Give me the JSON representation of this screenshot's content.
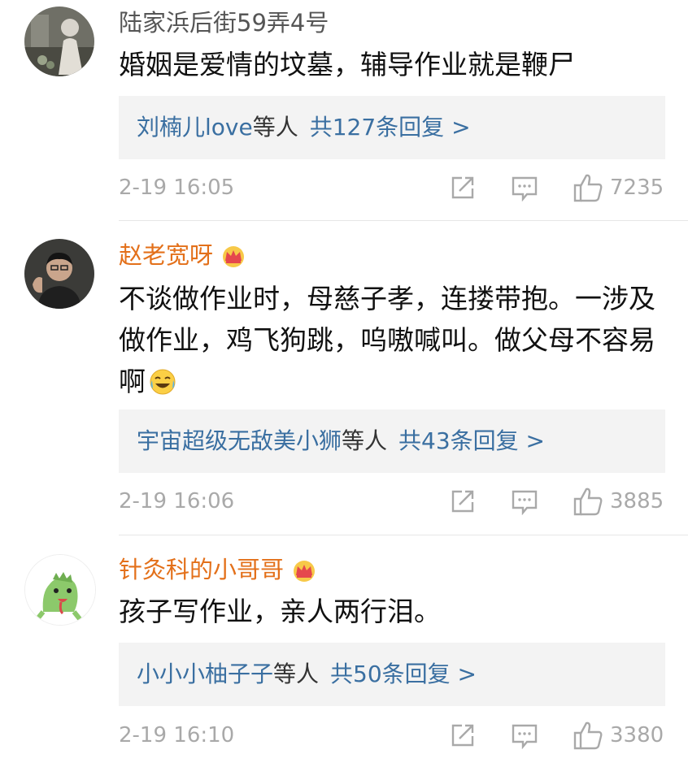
{
  "comments": [
    {
      "user": "陆家浜后街59弄4号",
      "vip": false,
      "text": "婚姻是爱情的坟墓，辅导作业就是鞭尸",
      "reply_names": "刘楠儿love",
      "reply_suffix": "等人",
      "reply_count": "共127条回复 >",
      "time": "2-19 16:05",
      "likes": "7235",
      "avatar": "photo-avatar"
    },
    {
      "user": "赵老宽呀",
      "vip": true,
      "text": "不谈做作业时，母慈子孝，连搂带抱。一涉及做作业，鸡飞狗跳，呜嗷喊叫。做父母不容易啊",
      "reply_names": "宇宙超级无敌美小狮",
      "reply_suffix": "等人",
      "reply_count": "共43条回复 >",
      "time": "2-19 16:06",
      "likes": "3885",
      "avatar": "person-avatar"
    },
    {
      "user": "针灸科的小哥哥",
      "vip": true,
      "text": "孩子写作业，亲人两行泪。",
      "reply_names": "小小小柚子子",
      "reply_suffix": "等人",
      "reply_count": "共50条回复 >",
      "time": "2-19 16:10",
      "likes": "3380",
      "avatar": "dinosaur-avatar"
    }
  ],
  "colors": {
    "vip_name": "#e3701a",
    "link": "#3a6fa1",
    "meta": "#a9a9a9",
    "reply_bg": "#f3f3f3"
  }
}
